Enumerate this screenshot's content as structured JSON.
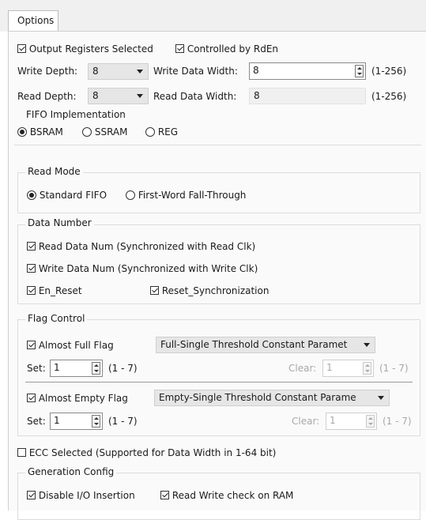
{
  "tab": {
    "label": "Options"
  },
  "top": {
    "output_registers": {
      "label": "Output Registers Selected",
      "checked": true
    },
    "controlled_by_rden": {
      "label": "Controlled by RdEn",
      "checked": true
    },
    "write_depth": {
      "label": "Write Depth:",
      "value": "8"
    },
    "write_data_width": {
      "label": "Write Data Width:",
      "value": "8",
      "range": "(1-256)"
    },
    "read_depth": {
      "label": "Read Depth:",
      "value": "8"
    },
    "read_data_width": {
      "label": "Read Data Width:",
      "value": "8",
      "range": "(1-256)"
    }
  },
  "fifo_impl": {
    "title": "FIFO Implementation",
    "options": [
      {
        "label": "BSRAM",
        "selected": true
      },
      {
        "label": "SSRAM",
        "selected": false
      },
      {
        "label": "REG",
        "selected": false
      }
    ]
  },
  "read_mode": {
    "title": "Read Mode",
    "options": [
      {
        "label": "Standard FIFO",
        "selected": true
      },
      {
        "label": "First-Word Fall-Through",
        "selected": false
      }
    ]
  },
  "data_number": {
    "title": "Data Number",
    "read_data_num": {
      "label": "Read Data Num (Synchronized with Read Clk)",
      "checked": true
    },
    "write_data_num": {
      "label": "Write Data Num (Synchronized with Write Clk)",
      "checked": true
    },
    "en_reset": {
      "label": "En_Reset",
      "checked": true
    },
    "reset_sync": {
      "label": "Reset_Synchronization",
      "checked": true
    }
  },
  "flag_control": {
    "title": "Flag Control",
    "almost_full": {
      "label": "Almost Full Flag",
      "checked": true,
      "mode": "Full-Single Threshold Constant Paramet",
      "set_label": "Set:",
      "set_value": "1",
      "set_range": "(1 - 7)",
      "clear_label": "Clear:",
      "clear_value": "1",
      "clear_range": "(1 - 7)"
    },
    "almost_empty": {
      "label": "Almost Empty Flag",
      "checked": true,
      "mode": "Empty-Single Threshold Constant Parame",
      "set_label": "Set:",
      "set_value": "1",
      "set_range": "(1 - 7)",
      "clear_label": "Clear:",
      "clear_value": "1",
      "clear_range": "(1 - 7)"
    }
  },
  "ecc": {
    "label": "ECC Selected (Supported for Data Width in 1-64 bit)",
    "checked": false
  },
  "generation": {
    "title": "Generation Config",
    "disable_io": {
      "label": "Disable I/O Insertion",
      "checked": true
    },
    "read_write_check": {
      "label": "Read Write check on RAM",
      "checked": true
    }
  }
}
